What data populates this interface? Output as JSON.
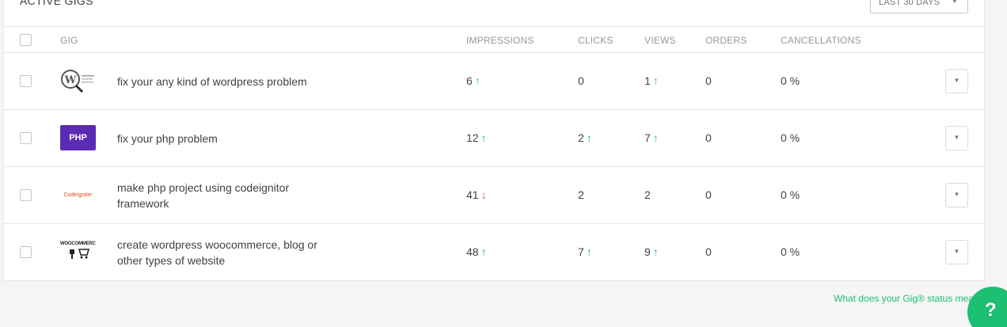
{
  "card": {
    "title": "ACTIVE GIGS",
    "period_select": "LAST 30 DAYS"
  },
  "headers": {
    "gig": "GIG",
    "impressions": "IMPRESSIONS",
    "clicks": "CLICKS",
    "views": "VIEWS",
    "orders": "ORDERS",
    "cancellations": "CANCELLATIONS"
  },
  "rows": [
    {
      "title": "fix your any kind of wordpress problem",
      "thumb_icon": "wordpress-thumbnail",
      "impressions": "6",
      "impressions_trend": "↑",
      "clicks": "0",
      "clicks_trend": "",
      "views": "1",
      "views_trend": "↑",
      "orders": "0",
      "cancellations": "0 %"
    },
    {
      "title": "fix your php problem",
      "thumb_icon": "php-thumbnail",
      "thumb_text": "PHP",
      "impressions": "12",
      "impressions_trend": "↑",
      "clicks": "2",
      "clicks_trend": "↑",
      "views": "7",
      "views_trend": "↑",
      "orders": "0",
      "cancellations": "0 %"
    },
    {
      "title": "make php project using codeignitor framework",
      "thumb_icon": "codeigniter-thumbnail",
      "thumb_text": "CodeIgniter",
      "impressions": "41",
      "impressions_trend": "↓",
      "clicks": "2",
      "clicks_trend": "",
      "views": "2",
      "views_trend": "",
      "orders": "0",
      "cancellations": "0 %"
    },
    {
      "title": "create wordpress woocommerce, blog or other types of website",
      "thumb_icon": "woocommerce-thumbnail",
      "thumb_text": "WOOCOMMERCE",
      "impressions": "48",
      "impressions_trend": "↑",
      "clicks": "7",
      "clicks_trend": "↑",
      "views": "9",
      "views_trend": "↑",
      "orders": "0",
      "cancellations": "0 %"
    }
  ],
  "footer": {
    "status_link": "What does your Gig® status mean?",
    "help_label": "?"
  },
  "colors": {
    "accent": "#1dbf73",
    "trend_up": "#1dbf73",
    "trend_down": "#e5484d",
    "php_brand": "#5b2bb3"
  },
  "icons": {
    "row_menu": "chevron-down-icon",
    "period_caret": "chevron-down-icon"
  }
}
